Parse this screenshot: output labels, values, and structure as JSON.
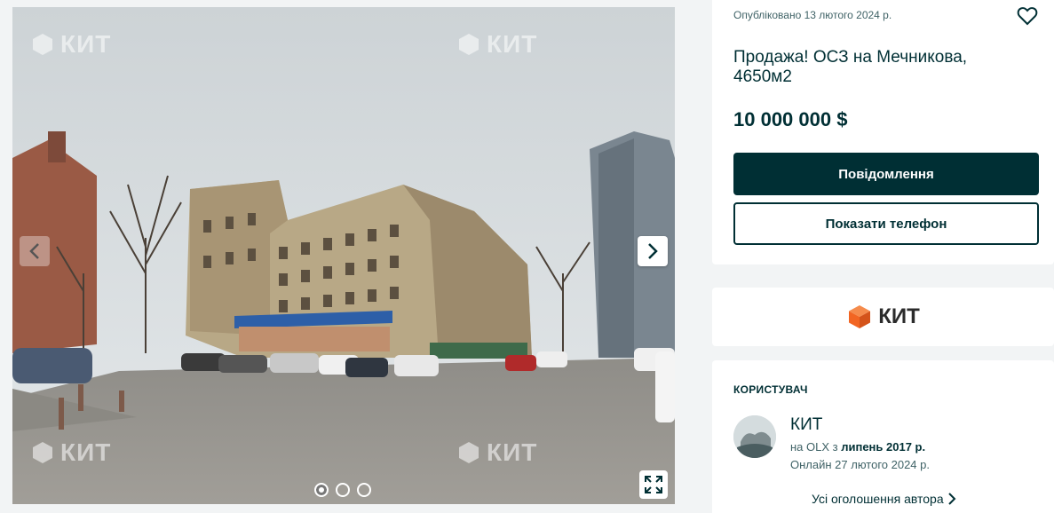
{
  "gallery": {
    "watermark_text": "КИТ",
    "photo_count": 3,
    "active_index": 0,
    "prev_icon": "chevron-left-icon",
    "next_icon": "chevron-right-icon",
    "fullscreen_icon": "expand-icon"
  },
  "listing": {
    "published": "Опубліковано 13 лютого 2024 р.",
    "title": "Продажа! ОСЗ на Мечникова, 4650м2",
    "price": "10 000 000 $",
    "message_button": "Повідомлення",
    "phone_button": "Показати телефон",
    "favorite_icon": "heart-icon"
  },
  "company": {
    "logo_text": "КИТ"
  },
  "user": {
    "section_title": "КОРИСТУВАЧ",
    "name": "КИТ",
    "since_prefix": "на OLX з ",
    "since_value": "липень 2017 р.",
    "online": "Онлайн 27 лютого 2024 р.",
    "all_ads_link": "Усі оголошення автора"
  },
  "colors": {
    "primary": "#002f34",
    "background": "#f2f4f5",
    "logo_orange": "#f26522"
  }
}
